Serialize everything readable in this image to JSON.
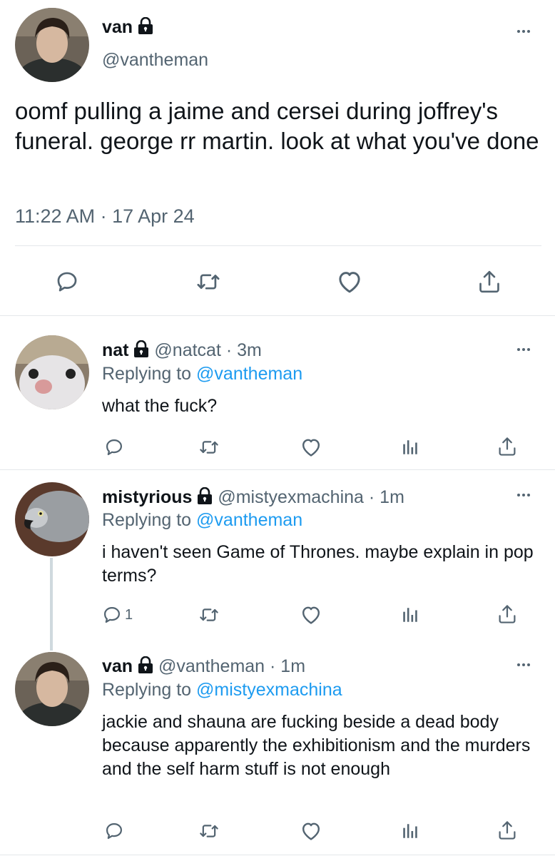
{
  "main_tweet": {
    "name": "van",
    "handle": "@vantheman",
    "text": "oomf pulling a jaime and cersei during joffrey's funeral. george rr martin. look at what you've done",
    "timestamp": "11:22 AM · 17 Apr 24",
    "actions": [
      "reply-icon",
      "retweet-icon",
      "like-icon",
      "share-icon"
    ]
  },
  "replies": [
    {
      "name": "nat",
      "handle": "@natcat",
      "time": "· 3m",
      "replying_prefix": "Replying to",
      "replying_to": "@vantheman",
      "text": "what the fuck?",
      "reply_count": ""
    },
    {
      "name": "mistyrious",
      "handle": "@mistyexmachina",
      "time": "· 1m",
      "replying_prefix": "Replying to",
      "replying_to": "@vantheman",
      "text": "i haven't seen Game of Thrones. maybe explain in pop terms?",
      "reply_count": "1"
    },
    {
      "name": "van",
      "handle": "@vantheman",
      "time": "· 1m",
      "replying_prefix": "Replying to",
      "replying_to": "@mistyexmachina",
      "text": "jackie and shauna are fucking beside a dead body because apparently the exhibitionism and the murders and the self harm stuff is not enough",
      "reply_count": ""
    }
  ],
  "colors": {
    "accent": "#1d9bf0",
    "text": "#0f1419",
    "muted": "#536471",
    "divider": "#e4e7ea"
  }
}
